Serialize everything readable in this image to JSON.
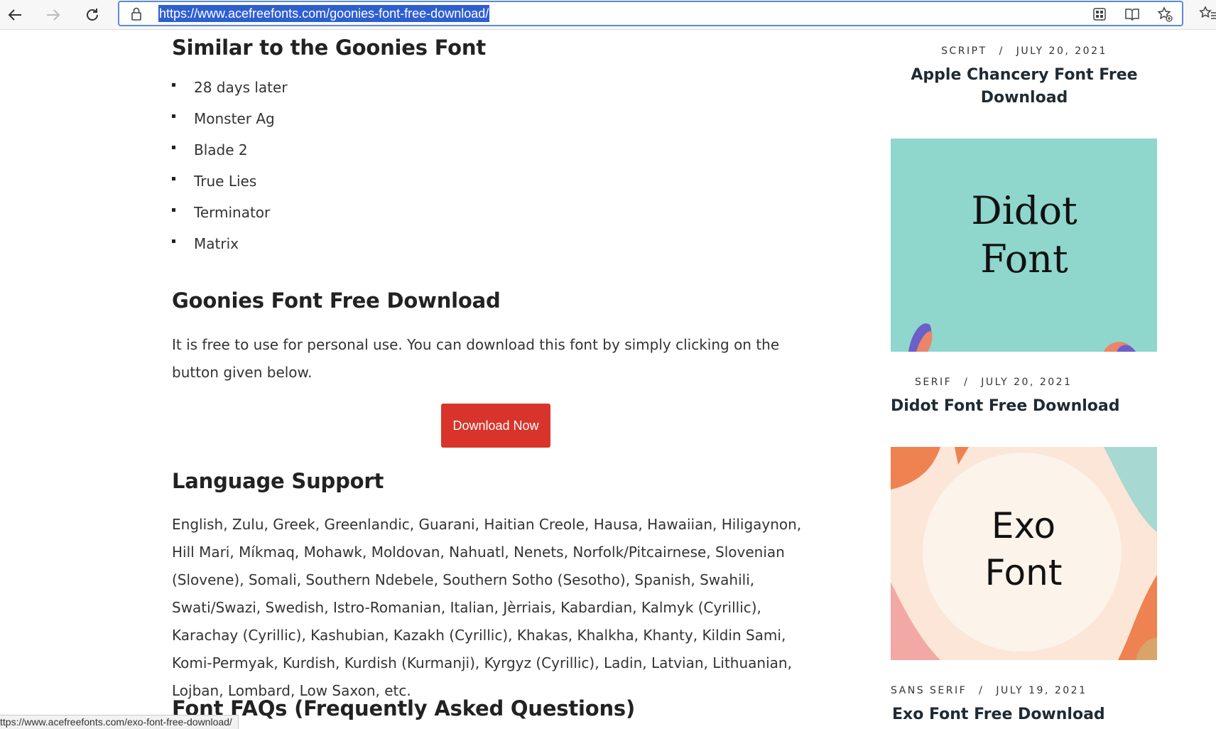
{
  "browser": {
    "url": "https://www.acefreefonts.com/goonies-font-free-download/",
    "status_url": "ttps://www.acefreefonts.com/exo-font-free-download/",
    "icons": [
      "back-arrow-icon",
      "forward-arrow-icon",
      "reload-icon",
      "lock-icon",
      "apps-grid-icon",
      "immersive-reader-icon",
      "add-favorite-icon",
      "favorites-icon"
    ]
  },
  "main": {
    "similar_heading": "Similar to the Goonies Font",
    "similar_fonts": [
      "28 days later",
      "Monster Ag",
      "Blade 2",
      "True Lies",
      "Terminator",
      "Matrix"
    ],
    "download_heading": "Goonies Font Free Download",
    "download_text": "It is free to use for personal use. You can download this font by simply clicking on the button given below.",
    "download_button": "Download Now",
    "language_heading": "Language Support",
    "language_text": "English, Zulu, Greek, Greenlandic, Guarani, Haitian Creole, Hausa, Hawaiian, Hiligaynon, Hill Mari, Míkmaq, Mohawk, Moldovan, Nahuatl, Nenets, Norfolk/Pitcairnese, Slovenian (Slovene), Somali, Southern Ndebele, Southern Sotho (Sesotho), Spanish, Swahili, Swati/Swazi, Swedish, Istro-Romanian, Italian, Jèrriais, Kabardian, Kalmyk (Cyrillic), Karachay (Cyrillic), Kashubian, Kazakh (Cyrillic), Khakas, Khalkha, Khanty, Kildin Sami, Komi-Permyak, Kurdish, Kurdish (Kurmanji), Kyrgyz (Cyrillic), Ladin, Latvian, Lithuanian, Lojban, Lombard, Low Saxon, etc.",
    "faq_heading": "Font FAQs (Frequently Asked Questions)"
  },
  "sidebar": {
    "posts": [
      {
        "category": "SCRIPT",
        "date": "JULY 20, 2021",
        "title": "Apple Chancery Font Free Download"
      },
      {
        "category": "SERIF",
        "date": "JULY 20, 2021",
        "title": "Didot Font Free Download",
        "thumb_line1": "Didot",
        "thumb_line2": "Font"
      },
      {
        "category": "SANS SERIF",
        "date": "JULY 19, 2021",
        "title": "Exo Font Free Download",
        "thumb_line1": "Exo",
        "thumb_line2": "Font"
      }
    ],
    "meta_separator": "/"
  },
  "colors": {
    "download_button": "#d9342b",
    "url_highlight": "#2e5fd1",
    "didot_bg": "#8fd6cd",
    "exo_bg": "#fcefe4",
    "exo_accent": "#ee8250"
  }
}
